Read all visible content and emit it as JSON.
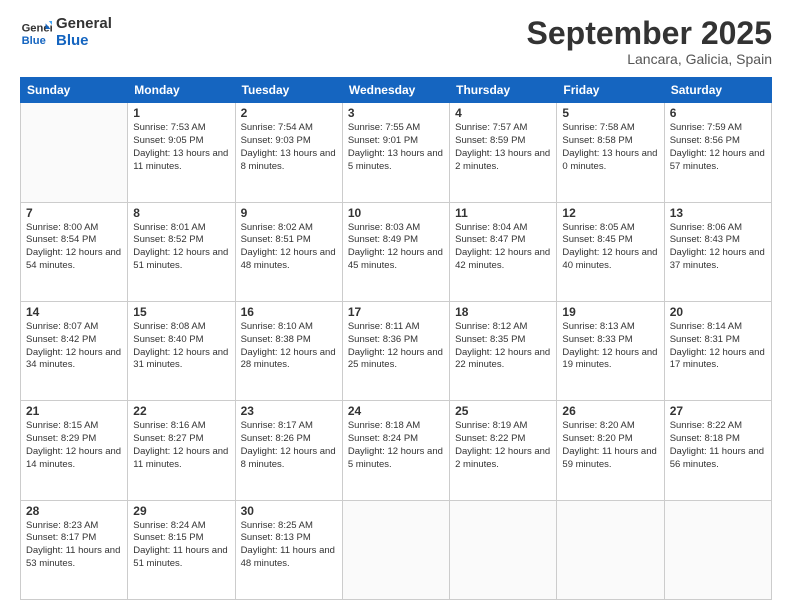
{
  "logo": {
    "line1": "General",
    "line2": "Blue"
  },
  "header": {
    "month": "September 2025",
    "location": "Lancara, Galicia, Spain"
  },
  "weekdays": [
    "Sunday",
    "Monday",
    "Tuesday",
    "Wednesday",
    "Thursday",
    "Friday",
    "Saturday"
  ],
  "weeks": [
    [
      {
        "day": "",
        "info": ""
      },
      {
        "day": "1",
        "info": "Sunrise: 7:53 AM\nSunset: 9:05 PM\nDaylight: 13 hours\nand 11 minutes."
      },
      {
        "day": "2",
        "info": "Sunrise: 7:54 AM\nSunset: 9:03 PM\nDaylight: 13 hours\nand 8 minutes."
      },
      {
        "day": "3",
        "info": "Sunrise: 7:55 AM\nSunset: 9:01 PM\nDaylight: 13 hours\nand 5 minutes."
      },
      {
        "day": "4",
        "info": "Sunrise: 7:57 AM\nSunset: 8:59 PM\nDaylight: 13 hours\nand 2 minutes."
      },
      {
        "day": "5",
        "info": "Sunrise: 7:58 AM\nSunset: 8:58 PM\nDaylight: 13 hours\nand 0 minutes."
      },
      {
        "day": "6",
        "info": "Sunrise: 7:59 AM\nSunset: 8:56 PM\nDaylight: 12 hours\nand 57 minutes."
      }
    ],
    [
      {
        "day": "7",
        "info": "Sunrise: 8:00 AM\nSunset: 8:54 PM\nDaylight: 12 hours\nand 54 minutes."
      },
      {
        "day": "8",
        "info": "Sunrise: 8:01 AM\nSunset: 8:52 PM\nDaylight: 12 hours\nand 51 minutes."
      },
      {
        "day": "9",
        "info": "Sunrise: 8:02 AM\nSunset: 8:51 PM\nDaylight: 12 hours\nand 48 minutes."
      },
      {
        "day": "10",
        "info": "Sunrise: 8:03 AM\nSunset: 8:49 PM\nDaylight: 12 hours\nand 45 minutes."
      },
      {
        "day": "11",
        "info": "Sunrise: 8:04 AM\nSunset: 8:47 PM\nDaylight: 12 hours\nand 42 minutes."
      },
      {
        "day": "12",
        "info": "Sunrise: 8:05 AM\nSunset: 8:45 PM\nDaylight: 12 hours\nand 40 minutes."
      },
      {
        "day": "13",
        "info": "Sunrise: 8:06 AM\nSunset: 8:43 PM\nDaylight: 12 hours\nand 37 minutes."
      }
    ],
    [
      {
        "day": "14",
        "info": "Sunrise: 8:07 AM\nSunset: 8:42 PM\nDaylight: 12 hours\nand 34 minutes."
      },
      {
        "day": "15",
        "info": "Sunrise: 8:08 AM\nSunset: 8:40 PM\nDaylight: 12 hours\nand 31 minutes."
      },
      {
        "day": "16",
        "info": "Sunrise: 8:10 AM\nSunset: 8:38 PM\nDaylight: 12 hours\nand 28 minutes."
      },
      {
        "day": "17",
        "info": "Sunrise: 8:11 AM\nSunset: 8:36 PM\nDaylight: 12 hours\nand 25 minutes."
      },
      {
        "day": "18",
        "info": "Sunrise: 8:12 AM\nSunset: 8:35 PM\nDaylight: 12 hours\nand 22 minutes."
      },
      {
        "day": "19",
        "info": "Sunrise: 8:13 AM\nSunset: 8:33 PM\nDaylight: 12 hours\nand 19 minutes."
      },
      {
        "day": "20",
        "info": "Sunrise: 8:14 AM\nSunset: 8:31 PM\nDaylight: 12 hours\nand 17 minutes."
      }
    ],
    [
      {
        "day": "21",
        "info": "Sunrise: 8:15 AM\nSunset: 8:29 PM\nDaylight: 12 hours\nand 14 minutes."
      },
      {
        "day": "22",
        "info": "Sunrise: 8:16 AM\nSunset: 8:27 PM\nDaylight: 12 hours\nand 11 minutes."
      },
      {
        "day": "23",
        "info": "Sunrise: 8:17 AM\nSunset: 8:26 PM\nDaylight: 12 hours\nand 8 minutes."
      },
      {
        "day": "24",
        "info": "Sunrise: 8:18 AM\nSunset: 8:24 PM\nDaylight: 12 hours\nand 5 minutes."
      },
      {
        "day": "25",
        "info": "Sunrise: 8:19 AM\nSunset: 8:22 PM\nDaylight: 12 hours\nand 2 minutes."
      },
      {
        "day": "26",
        "info": "Sunrise: 8:20 AM\nSunset: 8:20 PM\nDaylight: 11 hours\nand 59 minutes."
      },
      {
        "day": "27",
        "info": "Sunrise: 8:22 AM\nSunset: 8:18 PM\nDaylight: 11 hours\nand 56 minutes."
      }
    ],
    [
      {
        "day": "28",
        "info": "Sunrise: 8:23 AM\nSunset: 8:17 PM\nDaylight: 11 hours\nand 53 minutes."
      },
      {
        "day": "29",
        "info": "Sunrise: 8:24 AM\nSunset: 8:15 PM\nDaylight: 11 hours\nand 51 minutes."
      },
      {
        "day": "30",
        "info": "Sunrise: 8:25 AM\nSunset: 8:13 PM\nDaylight: 11 hours\nand 48 minutes."
      },
      {
        "day": "",
        "info": ""
      },
      {
        "day": "",
        "info": ""
      },
      {
        "day": "",
        "info": ""
      },
      {
        "day": "",
        "info": ""
      }
    ]
  ]
}
